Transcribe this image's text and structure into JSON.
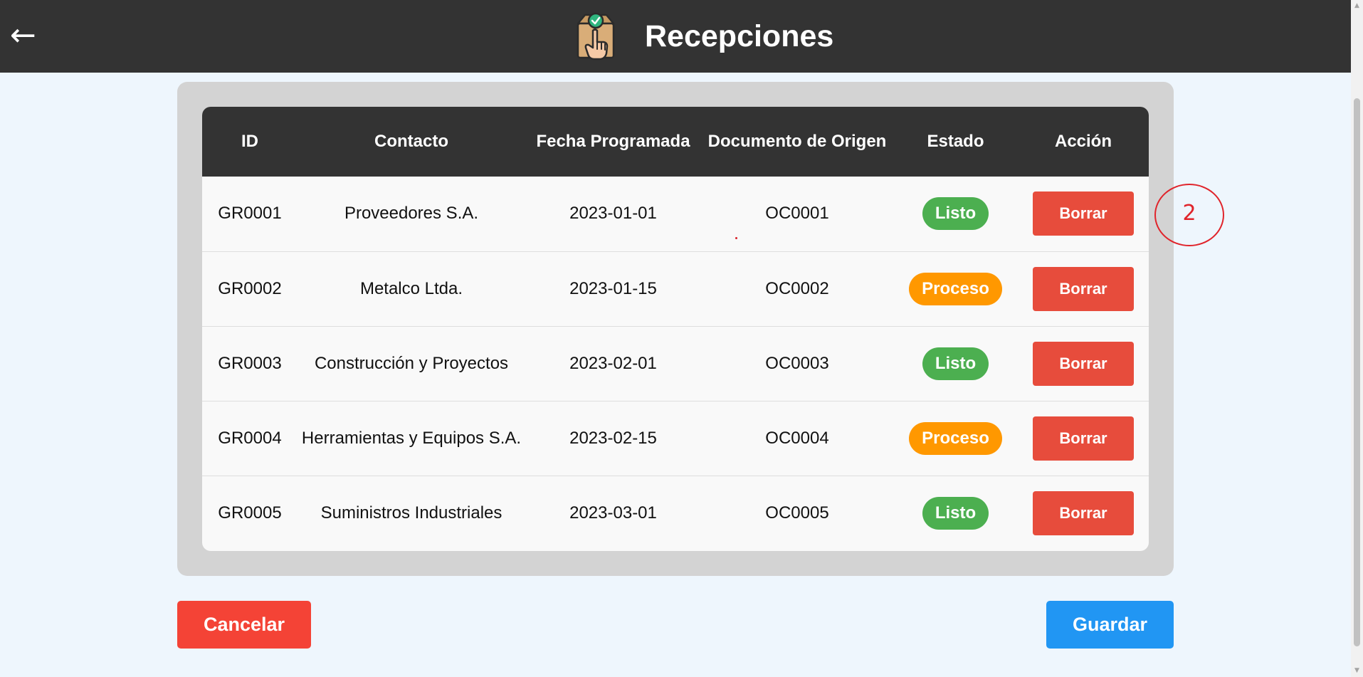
{
  "header": {
    "back_icon": "←",
    "logo_icon": "box-hand-check-icon",
    "title": "Recepciones"
  },
  "table": {
    "columns": [
      "ID",
      "Contacto",
      "Fecha Programada",
      "Documento de Origen",
      "Estado",
      "Acción"
    ],
    "rows": [
      {
        "id": "GR0001",
        "contacto": "Proveedores S.A.",
        "fecha": "2023-01-01",
        "documento": "OC0001",
        "estado": "Listo",
        "accion": "Borrar"
      },
      {
        "id": "GR0002",
        "contacto": "Metalco Ltda.",
        "fecha": "2023-01-15",
        "documento": "OC0002",
        "estado": "Proceso",
        "accion": "Borrar"
      },
      {
        "id": "GR0003",
        "contacto": "Construcción y Proyectos",
        "fecha": "2023-02-01",
        "documento": "OC0003",
        "estado": "Listo",
        "accion": "Borrar"
      },
      {
        "id": "GR0004",
        "contacto": "Herramientas y Equipos S.A.",
        "fecha": "2023-02-15",
        "documento": "OC0004",
        "estado": "Proceso",
        "accion": "Borrar"
      },
      {
        "id": "GR0005",
        "contacto": "Suministros Industriales",
        "fecha": "2023-03-01",
        "documento": "OC0005",
        "estado": "Listo",
        "accion": "Borrar"
      }
    ]
  },
  "status_colors": {
    "Listo": "#4caf50",
    "Proceso": "#ff9800"
  },
  "annotation": {
    "number": "2"
  },
  "footer": {
    "cancel_label": "Cancelar",
    "save_label": "Guardar",
    "cancel_color": "#f44336",
    "save_color": "#2196f3"
  }
}
